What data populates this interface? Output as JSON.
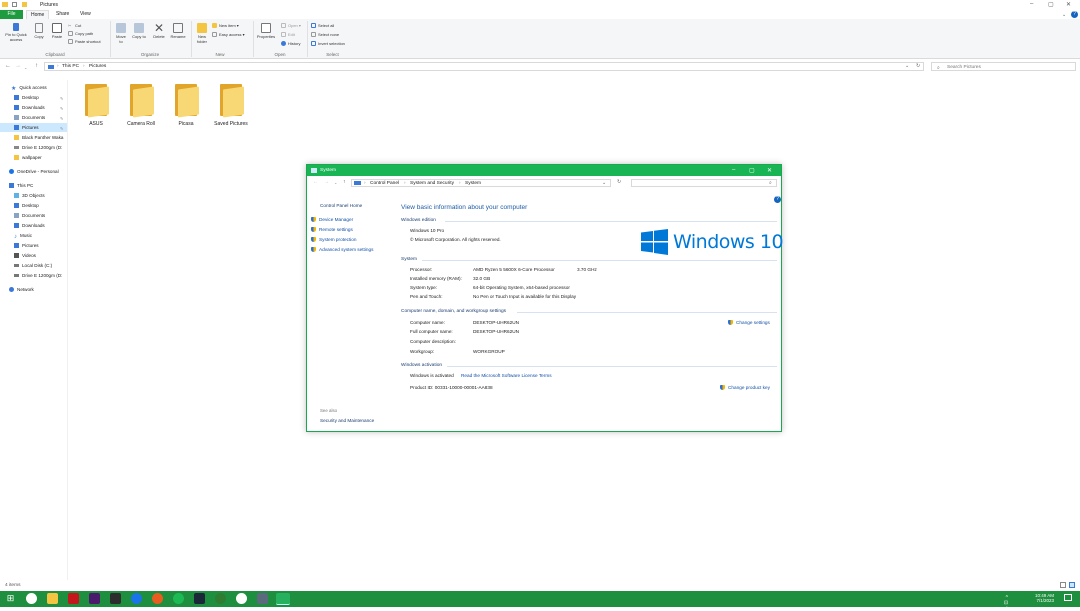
{
  "explorer": {
    "title": "Pictures",
    "tabs": [
      "File",
      "Home",
      "Share",
      "View"
    ],
    "ribbon": {
      "clipboard": {
        "pin": "Pin to Quick access",
        "copy": "Copy",
        "paste": "Paste",
        "cut": "Cut",
        "copy_path": "Copy path",
        "paste_shortcut": "Paste shortcut",
        "group": "Clipboard"
      },
      "organize": {
        "move_to": "Move to",
        "copy_to": "Copy to",
        "delete": "Delete",
        "rename": "Rename",
        "group": "Organize"
      },
      "new": {
        "new_folder": "New folder",
        "new_item": "New item",
        "easy_access": "Easy access",
        "group": "New"
      },
      "open": {
        "properties": "Properties",
        "open": "Open",
        "edit": "Edit",
        "history": "History",
        "group": "Open"
      },
      "select": {
        "select_all": "Select all",
        "select_none": "Select none",
        "invert": "Invert selection",
        "group": "Select"
      }
    },
    "address": {
      "crumbs": [
        "This PC",
        "Pictures"
      ]
    },
    "search_placeholder": "Search Pictures",
    "nav": {
      "quick_access": "Quick access",
      "quick_items": [
        "Desktop",
        "Downloads",
        "Documents",
        "Pictures",
        "Black Panther Waka",
        "Drive E 1200gm (D:",
        "wallpaper"
      ],
      "onedrive": "OneDrive - Personal",
      "this_pc": "This PC",
      "pc_items": [
        "3D Objects",
        "Desktop",
        "Documents",
        "Downloads",
        "Music",
        "Pictures",
        "Videos",
        "Local Disk (C:)",
        "Drive E 1200gm (D:"
      ],
      "network": "Network"
    },
    "folders": [
      "ASUS",
      "Camera Roll",
      "Picasa",
      "Saved Pictures"
    ],
    "status": "4 items"
  },
  "system_window": {
    "title": "System",
    "address": [
      "Control Panel",
      "System and Security",
      "System"
    ],
    "left_links": {
      "home": "Control Panel Home",
      "items": [
        "Device Manager",
        "Remote settings",
        "System protection",
        "Advanced system settings"
      ],
      "see_also": "See also",
      "security": "Security and Maintenance"
    },
    "heading": "View basic information about your computer",
    "edition_section": "Windows edition",
    "edition": "Windows 10 Pro",
    "copyright": "© Microsoft Corporation. All rights reserved.",
    "logo_text": "Windows 10",
    "system_section": "System",
    "system_rows": [
      {
        "label": "Processor:",
        "value": "AMD Ryzen 5 5600X 6-Core Processor",
        "extra": "3.70 GHz"
      },
      {
        "label": "Installed memory (RAM):",
        "value": "32.0 GB"
      },
      {
        "label": "System type:",
        "value": "64-bit Operating System, x64-based processor"
      },
      {
        "label": "Pen and Touch:",
        "value": "No Pen or Touch Input is available for this Display"
      }
    ],
    "name_section": "Computer name, domain, and workgroup settings",
    "name_rows": [
      {
        "label": "Computer name:",
        "value": "DESKTOP-UHR62UN"
      },
      {
        "label": "Full computer name:",
        "value": "DESKTOP-UHR62UN"
      },
      {
        "label": "Computer description:",
        "value": ""
      },
      {
        "label": "Workgroup:",
        "value": "WORKGROUP"
      }
    ],
    "change_settings": "Change settings",
    "activation_section": "Windows activation",
    "activated": "Windows is activated",
    "license_link": "Read the Microsoft Software License Terms",
    "product_id": "Product ID: 00331-10000-00001-AA838",
    "change_key": "Change product key"
  },
  "taskbar": {
    "time": "10:49 AM",
    "date": "7/1/2023"
  }
}
